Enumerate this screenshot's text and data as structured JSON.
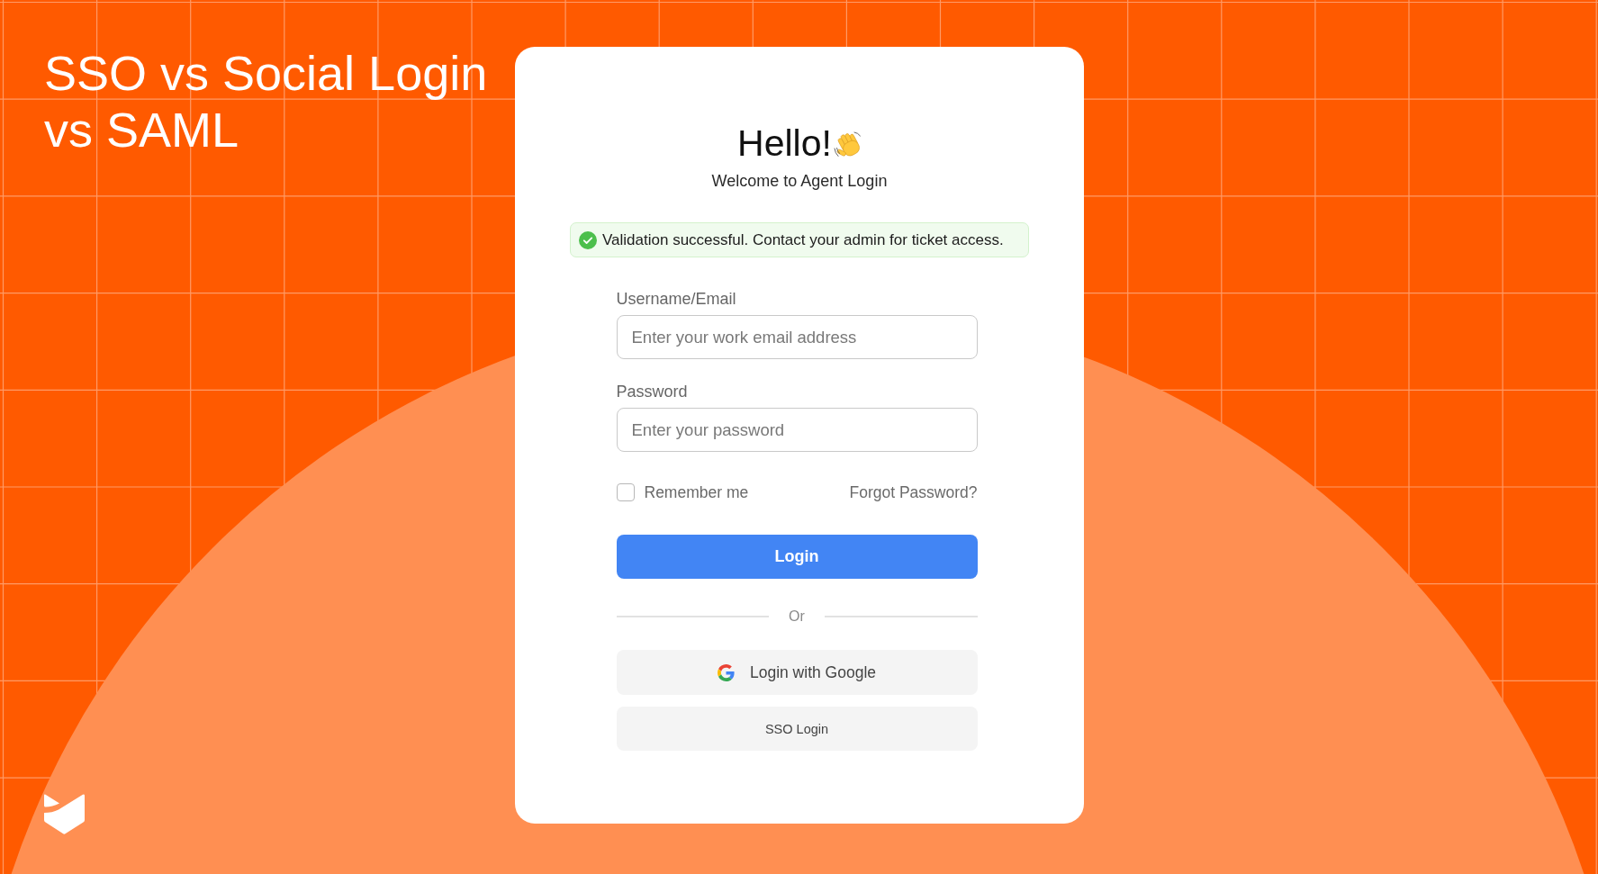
{
  "title": "SSO vs Social Login vs SAML",
  "card": {
    "heading": "Hello!",
    "subheading": "Welcome to Agent Login",
    "alert": {
      "kind": "success",
      "message": "Validation successful. Contact your admin for ticket access."
    },
    "fields": [
      {
        "label": "Username/Email",
        "placeholder": "Enter your work email address"
      },
      {
        "label": "Password",
        "placeholder": "Enter your password"
      }
    ],
    "remember": {
      "label": "Remember me",
      "checked": false
    },
    "forgot_link": "Forgot Password?",
    "login_button": "Login",
    "divider": "Or",
    "alt_buttons": [
      {
        "kind": "google",
        "label": "Login with Google"
      },
      {
        "kind": "sso",
        "label": "SSO Login"
      }
    ]
  }
}
